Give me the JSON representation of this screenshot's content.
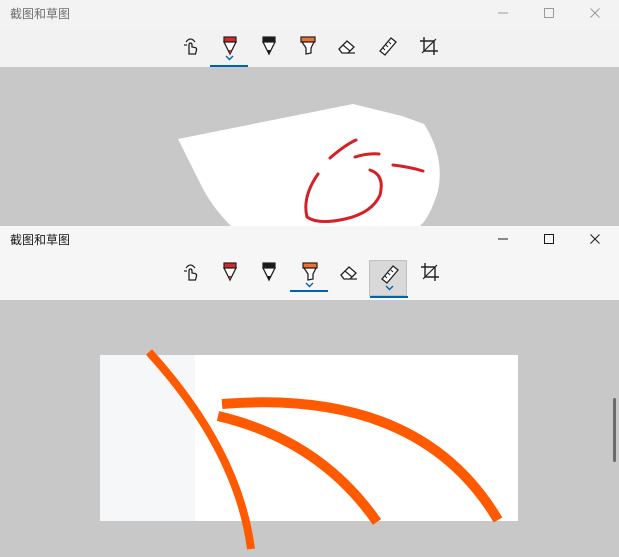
{
  "windows": [
    {
      "title": "截图和草图",
      "tools": [
        {
          "name": "touch-writing",
          "icon": "touch-hand-icon"
        },
        {
          "name": "ballpoint-pen",
          "icon": "ballpoint-pen-icon",
          "color": "#d62828",
          "selected": true
        },
        {
          "name": "pencil",
          "icon": "pencil-icon",
          "color": "#1a1a1a"
        },
        {
          "name": "highlighter",
          "icon": "highlighter-icon",
          "color": "#f07030"
        },
        {
          "name": "eraser",
          "icon": "eraser-icon"
        },
        {
          "name": "ruler",
          "icon": "ruler-icon"
        },
        {
          "name": "crop",
          "icon": "crop-icon"
        }
      ],
      "ink_color": "#d61f26"
    },
    {
      "title": "截图和草图",
      "tools": [
        {
          "name": "touch-writing",
          "icon": "touch-hand-icon"
        },
        {
          "name": "ballpoint-pen",
          "icon": "ballpoint-pen-icon",
          "color": "#d62828"
        },
        {
          "name": "pencil",
          "icon": "pencil-icon",
          "color": "#1a1a1a"
        },
        {
          "name": "highlighter",
          "icon": "highlighter-icon",
          "color": "#f07030",
          "selected": true
        },
        {
          "name": "eraser",
          "icon": "eraser-icon"
        },
        {
          "name": "ruler",
          "icon": "ruler-icon",
          "active": true
        },
        {
          "name": "crop",
          "icon": "crop-icon"
        }
      ],
      "ink_color": "#ff5a00"
    }
  ],
  "colors": {
    "accent": "#0063b1",
    "canvas_bg": "#c8c8c8",
    "toolbar_bg": "#f3f3f3"
  }
}
